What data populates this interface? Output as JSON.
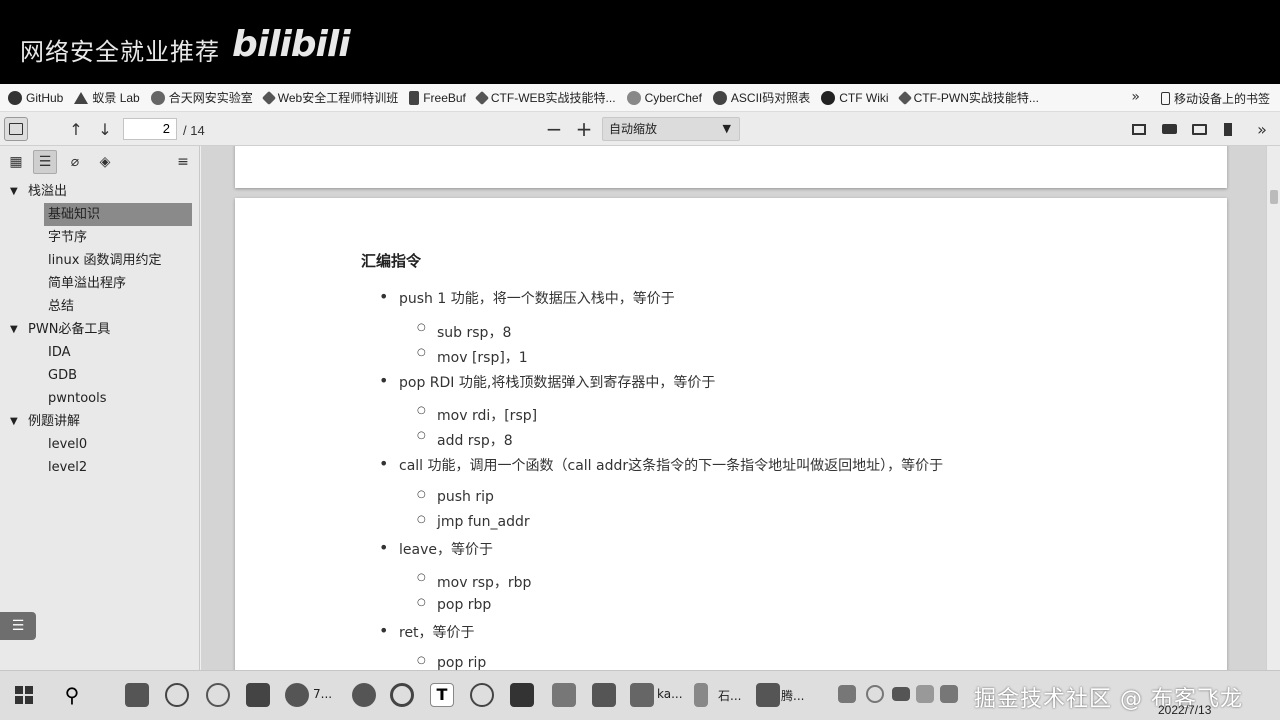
{
  "banner": {
    "title": "网络安全就业推荐",
    "logo": "bilibili"
  },
  "bookmarks": [
    {
      "label": "GitHub",
      "icon": "github-icon"
    },
    {
      "label": "蚁景 Lab",
      "icon": "lab-icon"
    },
    {
      "label": "合天网安实验室",
      "icon": "shield-icon"
    },
    {
      "label": "Web安全工程师特训班",
      "icon": "diamond-icon"
    },
    {
      "label": "FreeBuf",
      "icon": "freebuf-icon"
    },
    {
      "label": "CTF-WEB实战技能特...",
      "icon": "diamond-icon"
    },
    {
      "label": "CyberChef",
      "icon": "chef-icon"
    },
    {
      "label": "ASCII码对照表",
      "icon": "c-icon"
    },
    {
      "label": "CTF Wiki",
      "icon": "wiki-icon"
    },
    {
      "label": "CTF-PWN实战技能特...",
      "icon": "diamond-icon"
    }
  ],
  "bookmarks_more": "»",
  "mobile_bookmarks": "移动设备上的书签",
  "toolbar": {
    "page_current": "2",
    "page_total": "/ 14",
    "zoom_label": "自动缩放",
    "zoom_out": "−",
    "zoom_in": "+"
  },
  "outline": [
    {
      "label": "栈溢出",
      "level": 0,
      "twisty": "▼"
    },
    {
      "label": "基础知识",
      "level": 1,
      "selected": true
    },
    {
      "label": "字节序",
      "level": 1
    },
    {
      "label": "linux 函数调用约定",
      "level": 1
    },
    {
      "label": "简单溢出程序",
      "level": 1
    },
    {
      "label": "总结",
      "level": 1
    },
    {
      "label": "PWN必备工具",
      "level": 0,
      "twisty": "▼"
    },
    {
      "label": "IDA",
      "level": 1
    },
    {
      "label": "GDB",
      "level": 1
    },
    {
      "label": "pwntools",
      "level": 1
    },
    {
      "label": "例题讲解",
      "level": 0,
      "twisty": "▼"
    },
    {
      "label": "level0",
      "level": 1
    },
    {
      "label": "level2",
      "level": 1
    }
  ],
  "document": {
    "heading": "汇编指令",
    "items": [
      {
        "text": "push    1   功能，将一个数据压入栈中，等价于",
        "subs": [
          "sub rsp，8",
          "mov  [rsp]，1"
        ]
      },
      {
        "text": "pop    RDI   功能,将栈顶数据弹入到寄存器中，等价于",
        "subs": [
          "mov rdi，[rsp]",
          "add  rsp，8"
        ]
      },
      {
        "text": "call    功能，调用一个函数（call addr这条指令的下一条指令地址叫做返回地址），等价于",
        "subs": [
          "push rip",
          "jmp  fun_addr"
        ]
      },
      {
        "text": "leave，等价于",
        "subs": [
          "mov rsp，rbp",
          "pop  rbp"
        ]
      },
      {
        "text": "ret，等价于",
        "subs": [
          "pop rip"
        ]
      }
    ]
  },
  "taskbar": {
    "items": [
      "7...",
      "ka...",
      "石...",
      "腾..."
    ],
    "watermark": "掘金技术社区 @ 布客飞龙",
    "date": "2022/7/13"
  }
}
